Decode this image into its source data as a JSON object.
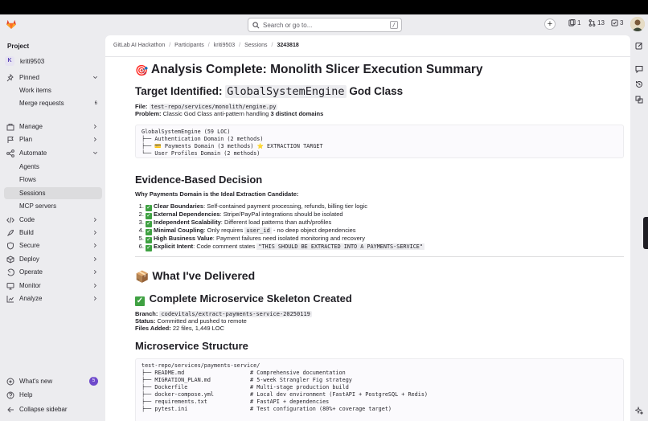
{
  "search": {
    "placeholder": "Search or go to...",
    "shortcut": "/"
  },
  "topbar": {
    "issues_count": "1",
    "merge_requests_count": "13",
    "todos_count": "3"
  },
  "sidebar": {
    "header": "Project",
    "project_initial": "K",
    "project_name": "kriti9503",
    "pinned": "Pinned",
    "work_items": "Work items",
    "merge_requests": "Merge requests",
    "merge_requests_count": "6",
    "manage": "Manage",
    "plan": "Plan",
    "automate": "Automate",
    "agents": "Agents",
    "flows": "Flows",
    "sessions": "Sessions",
    "mcp_servers": "MCP servers",
    "code": "Code",
    "build": "Build",
    "secure": "Secure",
    "deploy": "Deploy",
    "operate": "Operate",
    "monitor": "Monitor",
    "analyze": "Analyze",
    "whats_new": "What's new",
    "whats_new_count": "5",
    "help": "Help",
    "collapse": "Collapse sidebar"
  },
  "breadcrumbs": [
    "GitLab AI Hackathon",
    "Participants",
    "kriti9503",
    "Sessions",
    "3243818"
  ],
  "doc": {
    "title_emoji": "🎯",
    "title": "Analysis Complete: Monolith Slicer Execution Summary",
    "target_prefix": "Target Identified: ",
    "target_code": "GlobalSystemEngine",
    "target_suffix": " God Class",
    "file_label": "File:",
    "file_value": "test-repo/services/monolith/engine.py",
    "problem_label": "Problem:",
    "problem_text": "Classic God Class anti-pattern handling ",
    "problem_bold": "3 distinct domains",
    "tree1": [
      "GlobalSystemEngine (59 LOC)",
      "├── Authentication Domain (2 methods)",
      "├── 💳 Payments Domain (3 methods) ⭐ EXTRACTION TARGET",
      "└── User Profiles Domain (2 methods)"
    ],
    "evidence_heading": "Evidence-Based Decision",
    "evidence_sub": "Why Payments Domain is the Ideal Extraction Candidate:",
    "evidence": [
      {
        "bold": "Clear Boundaries",
        "text": ": Self-contained payment processing, refunds, billing tier logic"
      },
      {
        "bold": "External Dependencies",
        "text": ": Stripe/PayPal integrations should be isolated"
      },
      {
        "bold": "Independent Scalability",
        "text": ": Different load patterns than auth/profiles"
      },
      {
        "bold": "Minimal Coupling",
        "text": ": Only requires ",
        "code": "user_id",
        "text2": " - no deep object dependencies"
      },
      {
        "bold": "High Business Value",
        "text": ": Payment failures need isolated monitoring and recovery"
      },
      {
        "bold": "Explicit Intent",
        "text": ": Code comment states ",
        "code": "\"THIS SHOULD BE EXTRACTED INTO A PAYMENTS-SERVICE\""
      }
    ],
    "delivered_emoji": "📦",
    "delivered_heading": "What I've Delivered",
    "skeleton_emoji": "✅",
    "skeleton_heading": "Complete Microservice Skeleton Created",
    "branch_label": "Branch:",
    "branch_value": "codevitals/extract-payments-service-20250119",
    "status_label": "Status:",
    "status_value": "Committed and pushed to remote",
    "files_label": "Files Added:",
    "files_value": "22 files, 1,449 LOC",
    "structure_heading": "Microservice Structure",
    "tree2": [
      "test-repo/services/payments-service/",
      "├── README.md                    # Comprehensive documentation",
      "├── MIGRATION_PLAN.md            # 5-week Strangler Fig strategy",
      "├── Dockerfile                   # Multi-stage production build",
      "├── docker-compose.yml           # Local dev environment (FastAPI + PostgreSQL + Redis)",
      "├── requirements.txt             # FastAPI + dependencies",
      "├── pytest.ini                   # Test configuration (80%+ coverage target)"
    ]
  }
}
